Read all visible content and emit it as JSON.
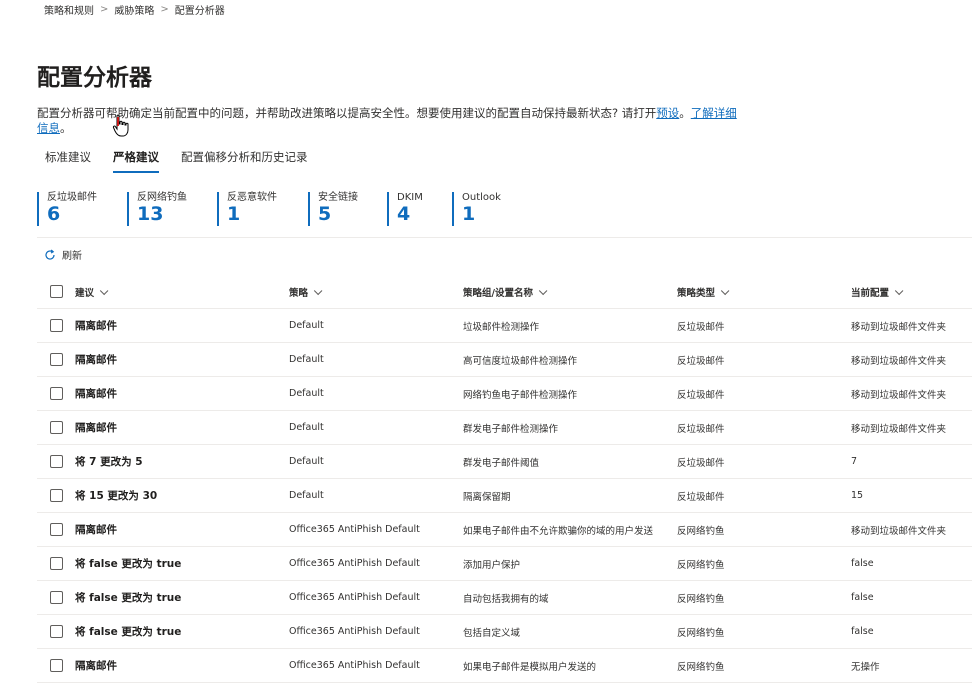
{
  "breadcrumb": [
    "策略和规则",
    "威胁策略",
    "配置分析器"
  ],
  "page_title": "配置分析器",
  "description": {
    "text": "配置分析器可帮助确定当前配置中的问题，并帮助改进策略以提高安全性。想要使用建议的配置自动保持最新状态? 请打开",
    "link1": "预设",
    "middle": "。",
    "link2": "了解详细信息",
    "end": "。"
  },
  "tabs": [
    {
      "label": "标准建议",
      "active": false
    },
    {
      "label": "严格建议",
      "active": true
    },
    {
      "label": "配置偏移分析和历史记录",
      "active": false
    }
  ],
  "stats": [
    {
      "label": "反垃圾邮件",
      "value": "6"
    },
    {
      "label": "反网络钓鱼",
      "value": "13"
    },
    {
      "label": "反恶意软件",
      "value": "1"
    },
    {
      "label": "安全链接",
      "value": "5"
    },
    {
      "label": "DKIM",
      "value": "4"
    },
    {
      "label": "Outlook",
      "value": "1"
    }
  ],
  "refresh_label": "刷新",
  "table": {
    "headers": [
      "建议",
      "策略",
      "策略组/设置名称",
      "策略类型",
      "当前配置"
    ],
    "rows": [
      [
        "隔离邮件",
        "Default",
        "垃圾邮件检测操作",
        "反垃圾邮件",
        "移动到垃圾邮件文件夹"
      ],
      [
        "隔离邮件",
        "Default",
        "高可信度垃圾邮件检测操作",
        "反垃圾邮件",
        "移动到垃圾邮件文件夹"
      ],
      [
        "隔离邮件",
        "Default",
        "网络钓鱼电子邮件检测操作",
        "反垃圾邮件",
        "移动到垃圾邮件文件夹"
      ],
      [
        "隔离邮件",
        "Default",
        "群发电子邮件检测操作",
        "反垃圾邮件",
        "移动到垃圾邮件文件夹"
      ],
      [
        "将 7 更改为 5",
        "Default",
        "群发电子邮件阈值",
        "反垃圾邮件",
        "7"
      ],
      [
        "将 15 更改为 30",
        "Default",
        "隔离保留期",
        "反垃圾邮件",
        "15"
      ],
      [
        "隔离邮件",
        "Office365 AntiPhish Default",
        "如果电子邮件由不允许欺骗你的域的用户发送",
        "反网络钓鱼",
        "移动到垃圾邮件文件夹"
      ],
      [
        "将 false 更改为 true",
        "Office365 AntiPhish Default",
        "添加用户保护",
        "反网络钓鱼",
        "false"
      ],
      [
        "将 false 更改为 true",
        "Office365 AntiPhish Default",
        "自动包括我拥有的域",
        "反网络钓鱼",
        "false"
      ],
      [
        "将 false 更改为 true",
        "Office365 AntiPhish Default",
        "包括自定义域",
        "反网络钓鱼",
        "false"
      ],
      [
        "隔离邮件",
        "Office365 AntiPhish Default",
        "如果电子邮件是模拟用户发送的",
        "反网络钓鱼",
        "无操作"
      ]
    ]
  },
  "colors": {
    "accent": "#0f6cbd",
    "text": "#323130",
    "divider": "#edebe9"
  }
}
